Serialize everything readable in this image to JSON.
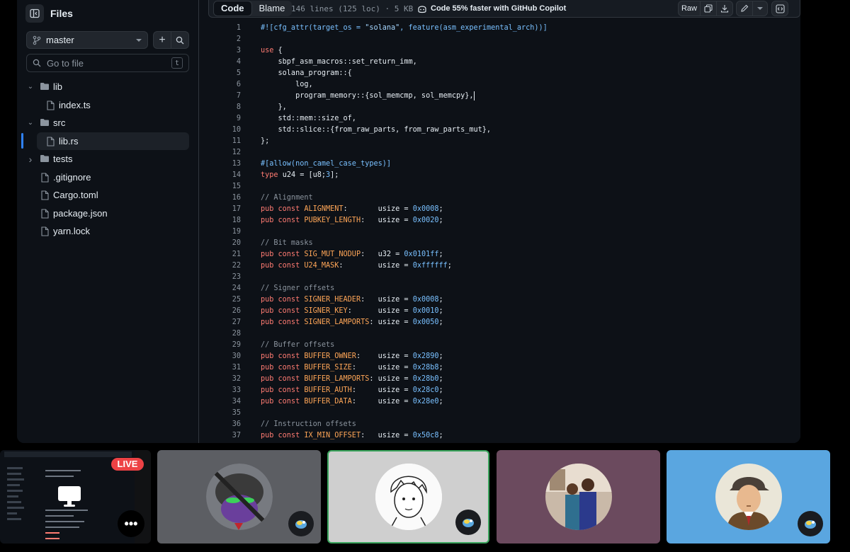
{
  "sidebar": {
    "title": "Files",
    "branch": "master",
    "search_placeholder": "Go to file",
    "search_shortcut": "t",
    "tree": [
      {
        "name": "lib",
        "type": "folder",
        "expanded": true,
        "depth": 0
      },
      {
        "name": "index.ts",
        "type": "file",
        "depth": 1
      },
      {
        "name": "src",
        "type": "folder",
        "expanded": true,
        "depth": 0
      },
      {
        "name": "lib.rs",
        "type": "file",
        "depth": 1,
        "selected": true
      },
      {
        "name": "tests",
        "type": "folder",
        "expanded": false,
        "depth": 0
      },
      {
        "name": ".gitignore",
        "type": "file",
        "depth": 0
      },
      {
        "name": "Cargo.toml",
        "type": "file",
        "depth": 0
      },
      {
        "name": "package.json",
        "type": "file",
        "depth": 0
      },
      {
        "name": "yarn.lock",
        "type": "file",
        "depth": 0
      }
    ]
  },
  "toolbar": {
    "tab_code": "Code",
    "tab_blame": "Blame",
    "file_meta": "146 lines (125 loc) · 5 KB",
    "copilot": "Code 55% faster with GitHub Copilot",
    "raw": "Raw"
  },
  "code": [
    [
      [
        "at",
        "#![cfg_attr(target_os = "
      ],
      [
        "st",
        "\"solana\""
      ],
      [
        "at",
        ", feature(asm_experimental_arch))]"
      ]
    ],
    [],
    [
      [
        "kw",
        "use"
      ],
      [
        "",
        "{"
      ]
    ],
    [
      [
        "",
        "    sbpf_asm_macros::set_return_imm,"
      ]
    ],
    [
      [
        "",
        "    solana_program::{"
      ]
    ],
    [
      [
        "",
        "        log,"
      ]
    ],
    [
      [
        "",
        "        program_memory::{sol_memcmp, sol_memcpy},"
      ]
    ],
    [
      [
        "",
        "    },"
      ]
    ],
    [
      [
        "",
        "    std::mem::size_of,"
      ]
    ],
    [
      [
        "",
        "    std::slice::{from_raw_parts, from_raw_parts_mut},"
      ]
    ],
    [
      [
        "",
        "};"
      ]
    ],
    [],
    [
      [
        "at",
        "#[allow(non_camel_case_types)]"
      ]
    ],
    [
      [
        "kw",
        "type"
      ],
      [
        "",
        "u24 = [u8;"
      ],
      [
        "nu",
        "3"
      ],
      [
        "",
        "];"
      ]
    ],
    [],
    [
      [
        "cm",
        "// Alignment"
      ]
    ],
    [
      [
        "kw",
        "pub const"
      ],
      [
        "cn",
        "ALIGNMENT"
      ],
      [
        "",
        ":       usize = "
      ],
      [
        "nu",
        "0x0008"
      ],
      [
        "",
        ";"
      ]
    ],
    [
      [
        "kw",
        "pub const"
      ],
      [
        "cn",
        "PUBKEY_LENGTH"
      ],
      [
        "",
        ":   usize = "
      ],
      [
        "nu",
        "0x0020"
      ],
      [
        "",
        ";"
      ]
    ],
    [],
    [
      [
        "cm",
        "// Bit masks"
      ]
    ],
    [
      [
        "kw",
        "pub const"
      ],
      [
        "cn",
        "SIG_MUT_NODUP"
      ],
      [
        "",
        ":   u32 = "
      ],
      [
        "nu",
        "0x0101ff"
      ],
      [
        "",
        ";"
      ]
    ],
    [
      [
        "kw",
        "pub const"
      ],
      [
        "cn",
        "U24_MASK"
      ],
      [
        "",
        ":        usize = "
      ],
      [
        "nu",
        "0xffffff"
      ],
      [
        "",
        ";"
      ]
    ],
    [],
    [
      [
        "cm",
        "// Signer offsets"
      ]
    ],
    [
      [
        "kw",
        "pub const"
      ],
      [
        "cn",
        "SIGNER_HEADER"
      ],
      [
        "",
        ":   usize = "
      ],
      [
        "nu",
        "0x0008"
      ],
      [
        "",
        ";"
      ]
    ],
    [
      [
        "kw",
        "pub const"
      ],
      [
        "cn",
        "SIGNER_KEY"
      ],
      [
        "",
        ":      usize = "
      ],
      [
        "nu",
        "0x0010"
      ],
      [
        "",
        ";"
      ]
    ],
    [
      [
        "kw",
        "pub const"
      ],
      [
        "cn",
        "SIGNER_LAMPORTS"
      ],
      [
        "",
        ": usize = "
      ],
      [
        "nu",
        "0x0050"
      ],
      [
        "",
        ";"
      ]
    ],
    [],
    [
      [
        "cm",
        "// Buffer offsets"
      ]
    ],
    [
      [
        "kw",
        "pub const"
      ],
      [
        "cn",
        "BUFFER_OWNER"
      ],
      [
        "",
        ":    usize = "
      ],
      [
        "nu",
        "0x2890"
      ],
      [
        "",
        ";"
      ]
    ],
    [
      [
        "kw",
        "pub const"
      ],
      [
        "cn",
        "BUFFER_SIZE"
      ],
      [
        "",
        ":     usize = "
      ],
      [
        "nu",
        "0x28b8"
      ],
      [
        "",
        ";"
      ]
    ],
    [
      [
        "kw",
        "pub const"
      ],
      [
        "cn",
        "BUFFER_LAMPORTS"
      ],
      [
        "",
        ": usize = "
      ],
      [
        "nu",
        "0x28b0"
      ],
      [
        "",
        ";"
      ]
    ],
    [
      [
        "kw",
        "pub const"
      ],
      [
        "cn",
        "BUFFER_AUTH"
      ],
      [
        "",
        ":     usize = "
      ],
      [
        "nu",
        "0x28c0"
      ],
      [
        "",
        ";"
      ]
    ],
    [
      [
        "kw",
        "pub const"
      ],
      [
        "cn",
        "BUFFER_DATA"
      ],
      [
        "",
        ":     usize = "
      ],
      [
        "nu",
        "0x28e0"
      ],
      [
        "",
        ";"
      ]
    ],
    [],
    [
      [
        "cm",
        "// Instruction offsets"
      ]
    ],
    [
      [
        "kw",
        "pub const"
      ],
      [
        "cn",
        "IX_MIN_OFFSET"
      ],
      [
        "",
        ":   usize = "
      ],
      [
        "nu",
        "0x50c8"
      ],
      [
        "",
        ";"
      ]
    ]
  ],
  "participants": {
    "live_label": "LIVE",
    "tiles": [
      {
        "kind": "screen",
        "bg": "#111214"
      },
      {
        "kind": "avatar",
        "bg": "#5c5e63",
        "avatar": "purple-creature-avatar"
      },
      {
        "kind": "avatar",
        "bg": "#cfcfcf",
        "avatar": "sketch-boy-avatar",
        "speaking": true
      },
      {
        "kind": "avatar",
        "bg": "#6b4a5e",
        "avatar": "couple-photo-avatar"
      },
      {
        "kind": "avatar",
        "bg": "#5aa6e0",
        "avatar": "cap-man-avatar"
      }
    ]
  },
  "colors": {
    "accent": "#2f81f7",
    "speaking_ring": "#3ba55d",
    "live": "#ed4245"
  }
}
